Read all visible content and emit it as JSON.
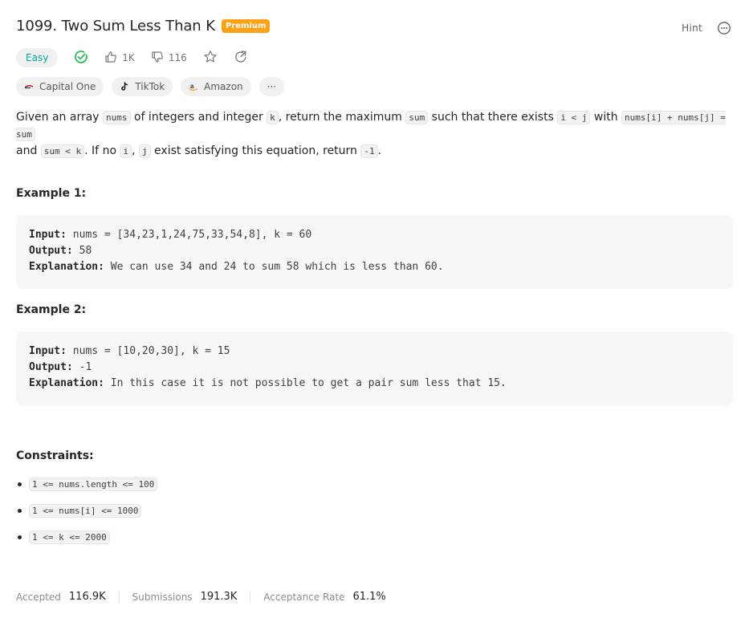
{
  "problem": {
    "title": "1099. Two Sum Less Than K",
    "premium_badge": "Premium",
    "hint_label": "Hint",
    "difficulty": "Easy",
    "likes": "1K",
    "dislikes": "116",
    "colors": {
      "accent": "#ffa116",
      "easy": "#00af9b",
      "solved": "#2cbb5d"
    }
  },
  "tags": [
    {
      "label": "Capital One",
      "icon": "capital-one-icon"
    },
    {
      "label": "TikTok",
      "icon": "tiktok-icon"
    },
    {
      "label": "Amazon",
      "icon": "amazon-icon"
    }
  ],
  "tags_more": "···",
  "description": {
    "t1": "Given an array ",
    "c1": "nums",
    "t2": " of integers and integer ",
    "c2": "k",
    "t3": ", return the maximum ",
    "c3": "sum",
    "t4": " such that there exists ",
    "c4": "i < j",
    "t5": " with ",
    "c5": "nums[i] + nums[j] = sum",
    "t6": " and ",
    "c6": "sum < k",
    "t7": ". If no ",
    "c7": "i",
    "t8": ", ",
    "c8": "j",
    "t9": " exist satisfying this equation, return ",
    "c9": "-1",
    "t10": "."
  },
  "examples": [
    {
      "title": "Example 1:",
      "input_label": "Input:",
      "input": "nums = [34,23,1,24,75,33,54,8], k = 60",
      "output_label": "Output:",
      "output": "58",
      "explanation_label": "Explanation:",
      "explanation": "We can use 34 and 24 to sum 58 which is less than 60."
    },
    {
      "title": "Example 2:",
      "input_label": "Input:",
      "input": "nums = [10,20,30], k = 15",
      "output_label": "Output:",
      "output": "-1",
      "explanation_label": "Explanation:",
      "explanation": "In this case it is not possible to get a pair sum less that 15."
    }
  ],
  "constraints_title": "Constraints:",
  "constraints": [
    "1 <= nums.length <= 100",
    "1 <= nums[i] <= 1000",
    "1 <= k <= 2000"
  ],
  "stats": {
    "accepted_label": "Accepted",
    "accepted": "116.9K",
    "submissions_label": "Submissions",
    "submissions": "191.3K",
    "rate_label": "Acceptance Rate",
    "rate": "61.1%"
  }
}
